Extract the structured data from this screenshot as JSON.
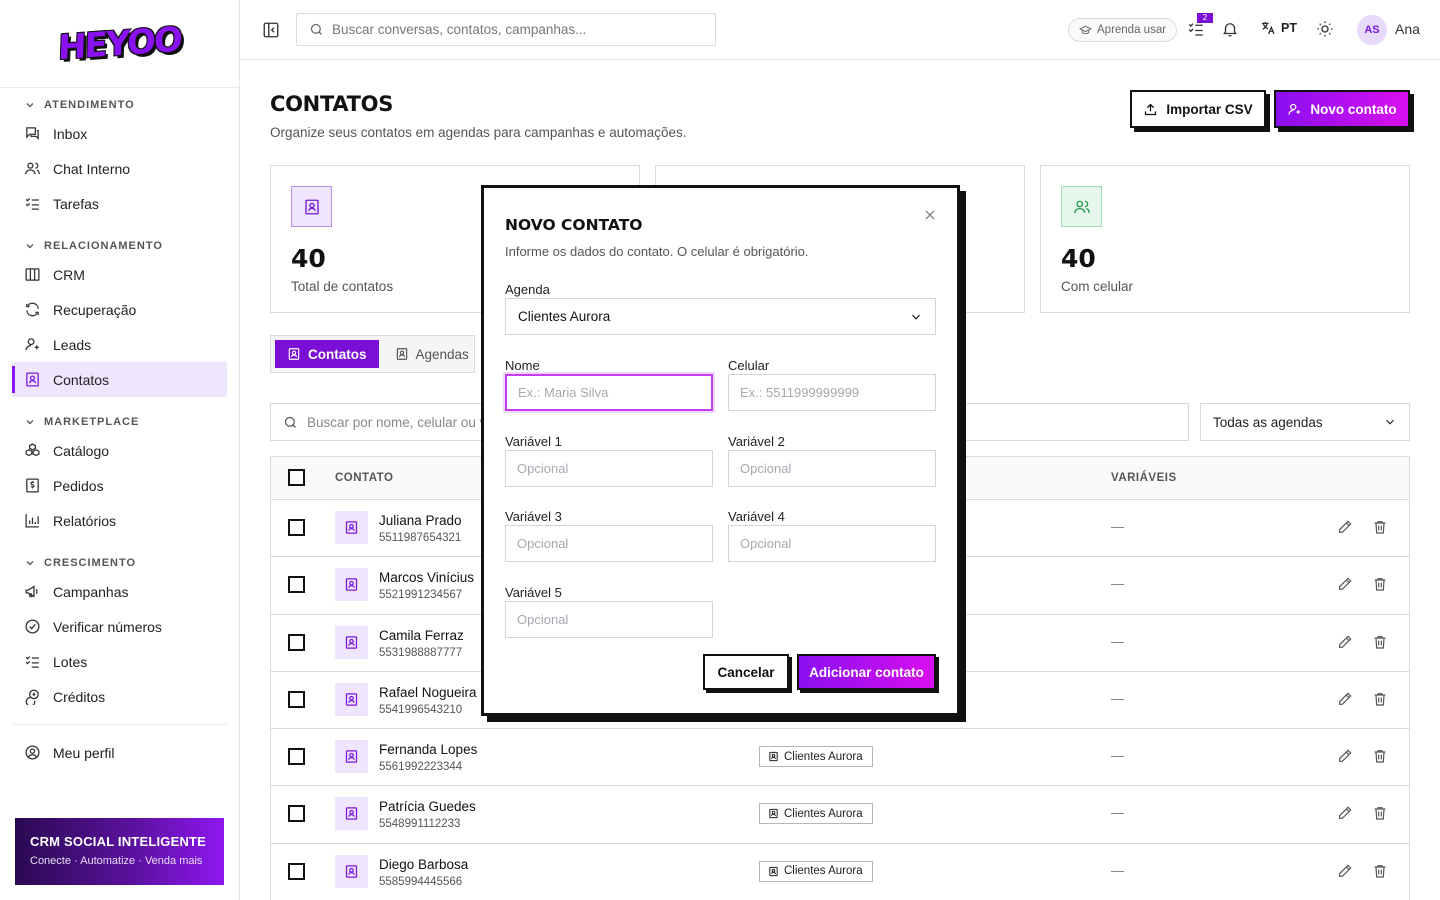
{
  "brand": {
    "logo": "HEYOO"
  },
  "sidebar": {
    "sections": [
      {
        "title": "ATENDIMENTO",
        "items": [
          {
            "label": "Inbox",
            "icon": "inbox-icon"
          },
          {
            "label": "Chat Interno",
            "icon": "users-icon"
          },
          {
            "label": "Tarefas",
            "icon": "list-check-icon"
          }
        ]
      },
      {
        "title": "RELACIONAMENTO",
        "items": [
          {
            "label": "CRM",
            "icon": "columns-icon"
          },
          {
            "label": "Recuperação",
            "icon": "refresh-icon"
          },
          {
            "label": "Leads",
            "icon": "user-plus-icon"
          },
          {
            "label": "Contatos",
            "icon": "contact-book-icon",
            "active": true
          }
        ]
      },
      {
        "title": "MARKETPLACE",
        "items": [
          {
            "label": "Catálogo",
            "icon": "boxes-icon"
          },
          {
            "label": "Pedidos",
            "icon": "receipt-icon"
          },
          {
            "label": "Relatórios",
            "icon": "bar-chart-icon"
          }
        ]
      },
      {
        "title": "CRESCIMENTO",
        "items": [
          {
            "label": "Campanhas",
            "icon": "megaphone-icon"
          },
          {
            "label": "Verificar números",
            "icon": "check-circle-icon"
          },
          {
            "label": "Lotes",
            "icon": "list-check-icon"
          },
          {
            "label": "Créditos",
            "icon": "coins-icon"
          }
        ]
      }
    ],
    "profile_label": "Meu perfil",
    "promo": {
      "title": "CRM SOCIAL INTELIGENTE",
      "subtitle": "Conecte · Automatize · Venda mais"
    }
  },
  "topbar": {
    "search_placeholder": "Buscar conversas, contatos, campanhas...",
    "learn_label": "Aprenda usar",
    "tasks_badge": "2",
    "language": "PT",
    "avatar_initials": "AS",
    "user_name": "Ana"
  },
  "page": {
    "title": "CONTATOS",
    "subtitle": "Organize seus contatos em agendas para campanhas e automações.",
    "import_label": "Importar CSV",
    "new_label": "Novo contato"
  },
  "stats": [
    {
      "value": "40",
      "label": "Total de contatos"
    },
    {
      "value": "40",
      "label": "Com celular"
    }
  ],
  "tabs": [
    {
      "label": "Contatos",
      "active": true
    },
    {
      "label": "Agendas",
      "active": false
    }
  ],
  "filters": {
    "search_placeholder": "Buscar por nome, celular ou variável...",
    "agenda_select": "Todas as agendas"
  },
  "table": {
    "columns": {
      "contact": "CONTATO",
      "vars": "VARIÁVEIS"
    },
    "rows": [
      {
        "name": "Juliana Prado",
        "phone": "5511987654321",
        "agenda": "",
        "vars": "—"
      },
      {
        "name": "Marcos Vinícius",
        "phone": "5521991234567",
        "agenda": "",
        "vars": "—"
      },
      {
        "name": "Camila Ferraz",
        "phone": "5531988887777",
        "agenda": "",
        "vars": "—"
      },
      {
        "name": "Rafael Nogueira",
        "phone": "5541996543210",
        "agenda": "",
        "vars": "—"
      },
      {
        "name": "Fernanda Lopes",
        "phone": "5561992223344",
        "agenda": "Clientes Aurora",
        "vars": "—"
      },
      {
        "name": "Patrícia Guedes",
        "phone": "5548991112233",
        "agenda": "Clientes Aurora",
        "vars": "—"
      },
      {
        "name": "Diego Barbosa",
        "phone": "5585994445566",
        "agenda": "Clientes Aurora",
        "vars": "—"
      }
    ]
  },
  "modal": {
    "title": "NOVO CONTATO",
    "subtitle": "Informe os dados do contato. O celular é obrigatório.",
    "agenda_label": "Agenda",
    "agenda_value": "Clientes Aurora",
    "name_label": "Nome",
    "name_placeholder": "Ex.: Maria Silva",
    "phone_label": "Celular",
    "phone_placeholder": "Ex.: 5511999999999",
    "var1_label": "Variável 1",
    "var2_label": "Variável 2",
    "var3_label": "Variável 3",
    "var4_label": "Variável 4",
    "var5_label": "Variável 5",
    "optional_placeholder": "Opcional",
    "cancel_label": "Cancelar",
    "submit_label": "Adicionar contato"
  }
}
